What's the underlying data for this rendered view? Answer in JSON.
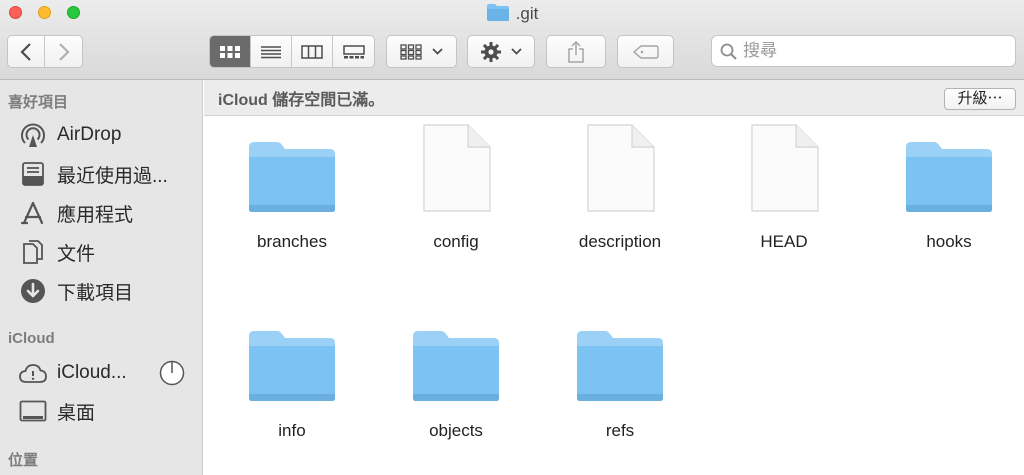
{
  "window": {
    "title": ".git"
  },
  "toolbar": {
    "search_placeholder": "搜尋"
  },
  "sidebar": {
    "favorites_header": "喜好項目",
    "favorites": [
      {
        "label": "AirDrop",
        "icon": "airdrop-icon"
      },
      {
        "label": "最近使用過...",
        "icon": "recents-icon"
      },
      {
        "label": "應用程式",
        "icon": "applications-icon"
      },
      {
        "label": "文件",
        "icon": "documents-icon"
      },
      {
        "label": "下載項目",
        "icon": "downloads-icon"
      }
    ],
    "icloud_header": "iCloud",
    "icloud": [
      {
        "label": "iCloud...",
        "icon": "icloud-drive-icon"
      },
      {
        "label": "桌面",
        "icon": "desktop-icon"
      }
    ],
    "locations_header": "位置"
  },
  "banner": {
    "text": "iCloud 儲存空間已滿。",
    "upgrade_label": "升級⋯"
  },
  "files": [
    {
      "name": "branches",
      "kind": "folder"
    },
    {
      "name": "config",
      "kind": "file"
    },
    {
      "name": "description",
      "kind": "file"
    },
    {
      "name": "HEAD",
      "kind": "file"
    },
    {
      "name": "hooks",
      "kind": "folder"
    },
    {
      "name": "info",
      "kind": "folder"
    },
    {
      "name": "objects",
      "kind": "folder"
    },
    {
      "name": "refs",
      "kind": "folder"
    }
  ],
  "colors": {
    "folder": "#7cc2f2",
    "folder_tab": "#9bd1f6",
    "sidebar_bg": "#e6e6e6",
    "active_view": "#6b6b6b"
  }
}
